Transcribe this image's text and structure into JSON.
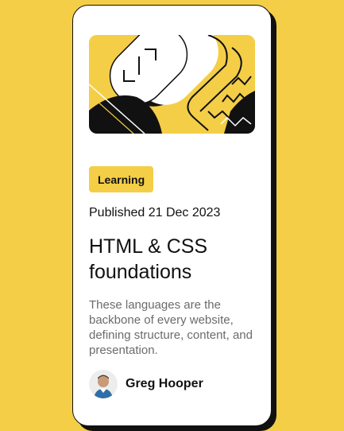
{
  "card": {
    "tag": "Learning",
    "published": "Published 21 Dec 2023",
    "title": "HTML & CSS foundations",
    "description": "These languages are the backbone of every website, defining structure, content, and presentation.",
    "author": {
      "name": "Greg Hooper",
      "avatar_icon": "author-avatar"
    },
    "illustration_icon": "abstract-illustration"
  },
  "colors": {
    "background": "#F4CE47",
    "card": "#FFFFFF",
    "ink": "#111111",
    "muted_text": "#6B6B6B"
  }
}
